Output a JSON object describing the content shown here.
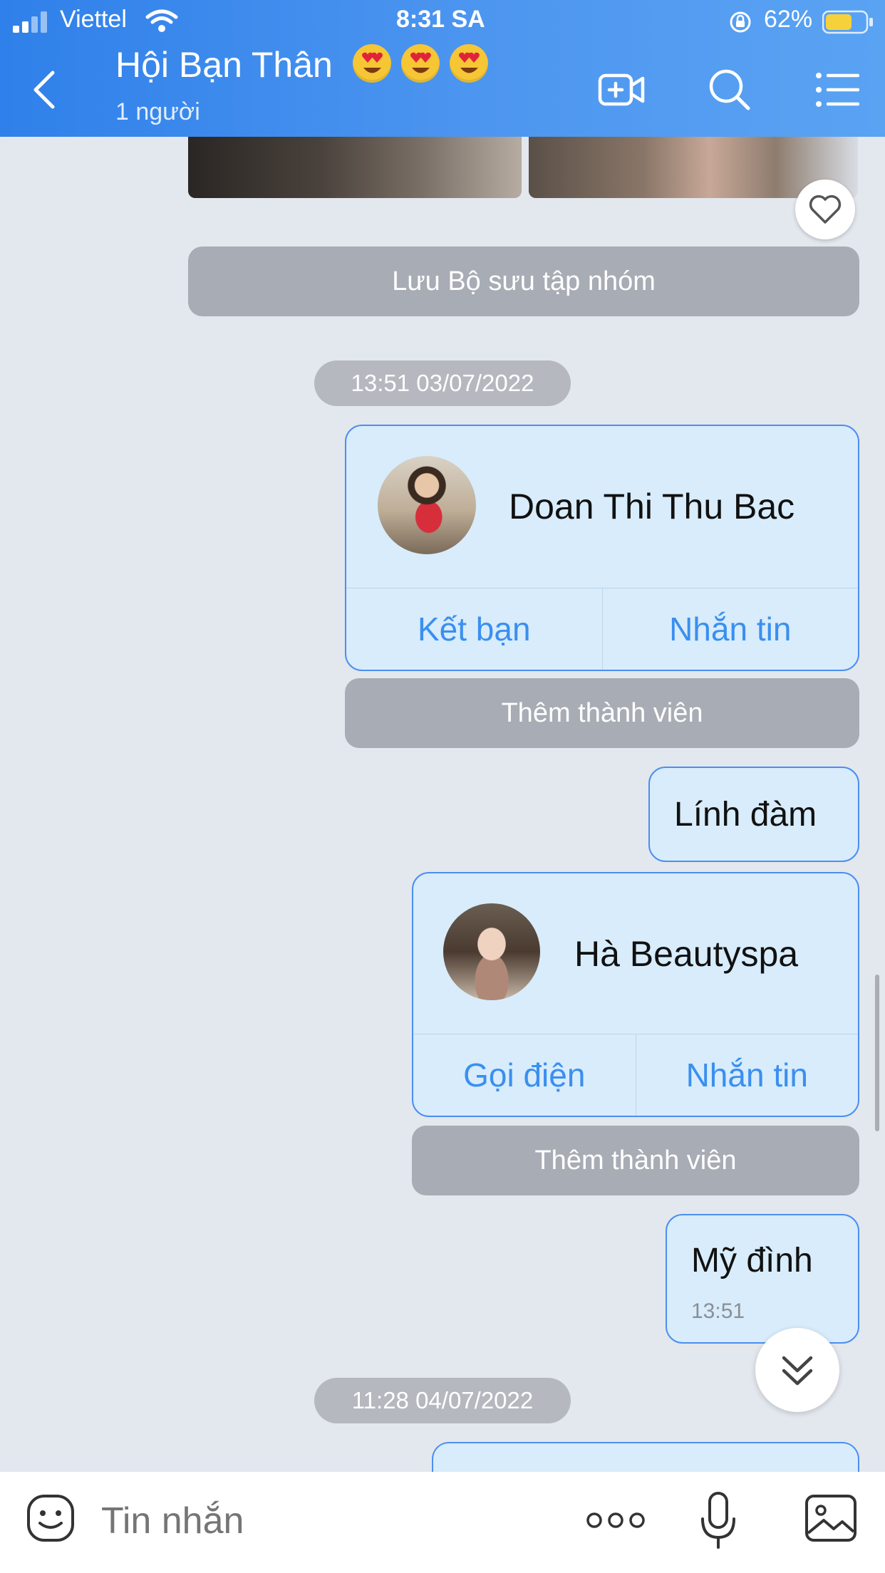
{
  "status_bar": {
    "carrier": "Viettel",
    "time": "8:31 SA",
    "battery": "62%"
  },
  "header": {
    "title": "Hội Bạn Thân",
    "subtitle": "1 người",
    "emoji_count": 3
  },
  "chat": {
    "save_collection": "Lưu Bộ sưu tập nhóm",
    "timestamp_1": "13:51 03/07/2022",
    "card_1": {
      "name": "Doan Thi Thu Bac",
      "action_left": "Kết bạn",
      "action_right": "Nhắn tin"
    },
    "add_member_1": "Thêm thành viên",
    "message_1": "Lính đàm",
    "card_2": {
      "name": "Hà Beautyspa",
      "action_left": "Gọi điện",
      "action_right": "Nhắn tin"
    },
    "add_member_2": "Thêm thành viên",
    "message_2": {
      "text": "Mỹ đình",
      "time": "13:51"
    },
    "timestamp_2": "11:28 04/07/2022"
  },
  "input": {
    "placeholder": "Tin nhắn"
  },
  "colors": {
    "header_blue": "#2f80ea",
    "bubble_bg": "#d8ecfb",
    "bubble_border": "#4b8ff0",
    "action_text": "#3a8ff0",
    "system_pill": "#a8acb4"
  }
}
